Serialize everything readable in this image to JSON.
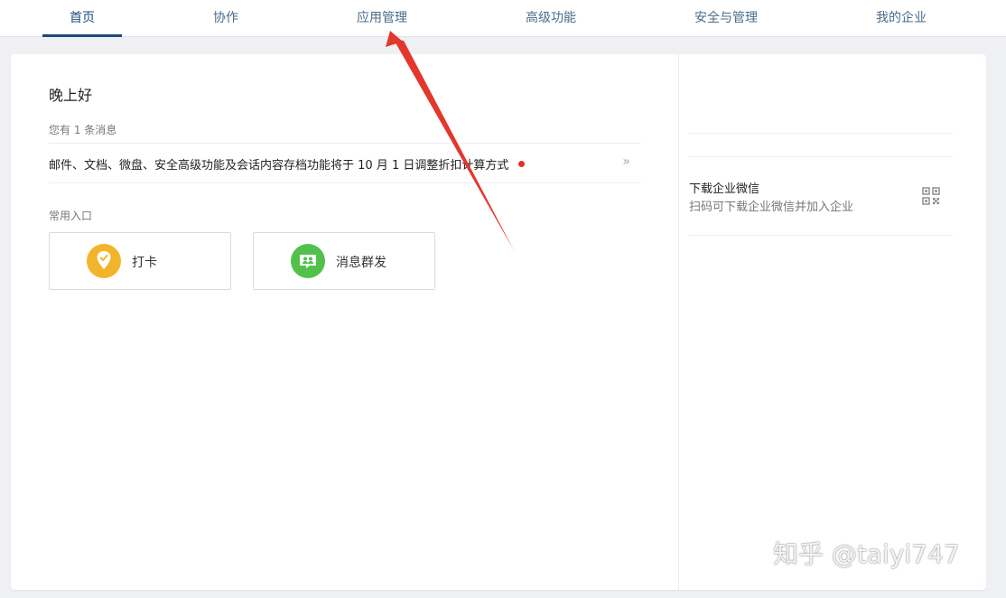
{
  "nav": {
    "tabs": [
      {
        "label": "首页",
        "active": true
      },
      {
        "label": "协作",
        "active": false
      },
      {
        "label": "应用管理",
        "active": false
      },
      {
        "label": "高级功能",
        "active": false
      },
      {
        "label": "安全与管理",
        "active": false
      },
      {
        "label": "我的企业",
        "active": false
      }
    ]
  },
  "main": {
    "greeting": "晚上好",
    "message_count": "您有 1 条消息",
    "message": {
      "text": "邮件、文档、微盘、安全高级功能及会话内容存档功能将于 10 月 1 日调整折扣计算方式",
      "arrow": "»",
      "unread_dot_color": "#e2312c"
    },
    "entries_title": "常用入口",
    "entries": [
      {
        "label": "打卡",
        "icon": "location-pin-icon",
        "color": "#f2b42a"
      },
      {
        "label": "消息群发",
        "icon": "group-message-icon",
        "color": "#52c14b"
      }
    ]
  },
  "side": {
    "download_title": "下载企业微信",
    "download_sub": "扫码可下载企业微信并加入企业",
    "qr_icon": "qr-code-icon"
  },
  "overlay": {
    "annotation_color": "#e3372d",
    "watermark": "知乎 @taiyi747"
  }
}
